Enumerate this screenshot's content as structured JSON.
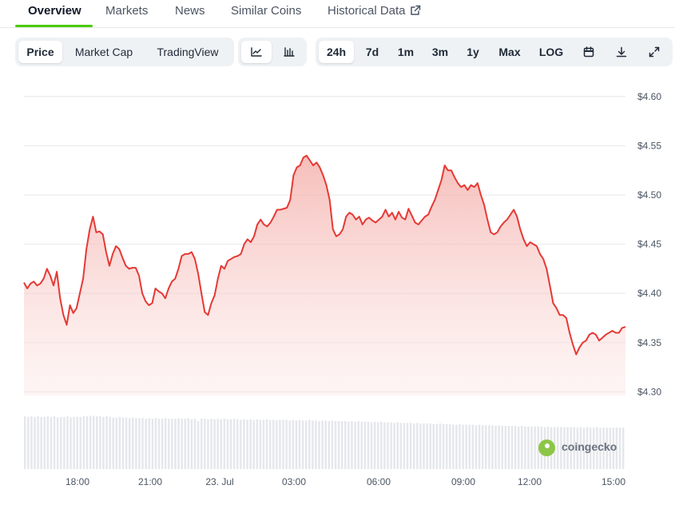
{
  "tabs": [
    {
      "label": "Overview",
      "active": true
    },
    {
      "label": "Markets"
    },
    {
      "label": "News"
    },
    {
      "label": "Similar Coins"
    },
    {
      "label": "Historical Data",
      "icon": "external-link-icon"
    }
  ],
  "metric_buttons": [
    {
      "label": "Price",
      "active": true
    },
    {
      "label": "Market Cap"
    },
    {
      "label": "TradingView"
    }
  ],
  "chart_type_buttons": [
    {
      "icon": "line-chart-icon",
      "active": true
    },
    {
      "icon": "candlestick-chart-icon"
    }
  ],
  "range_buttons": [
    {
      "label": "24h",
      "active": true
    },
    {
      "label": "7d"
    },
    {
      "label": "1m"
    },
    {
      "label": "3m"
    },
    {
      "label": "1y"
    },
    {
      "label": "Max"
    },
    {
      "label": "LOG"
    }
  ],
  "toolbar_icons": [
    "calendar-icon",
    "download-icon",
    "expand-icon"
  ],
  "watermark": "coingecko",
  "colors": {
    "accent": "#4bcc00",
    "line": "#e53935",
    "fill": "#f5c9c6",
    "grid": "#e5e7eb",
    "volume": "#e5e7eb"
  },
  "chart_data": {
    "type": "area",
    "title": "",
    "xlabel": "",
    "ylabel": "",
    "y_ticks": [
      "$4.60",
      "$4.55",
      "$4.50",
      "$4.45",
      "$4.40",
      "$4.35",
      "$4.30"
    ],
    "ylim": [
      4.28,
      4.625
    ],
    "x_ticks": [
      "18:00",
      "21:00",
      "23. Jul",
      "03:00",
      "06:00",
      "09:00",
      "12:00",
      "15:00"
    ],
    "grid": true,
    "legend": "none",
    "series": [
      {
        "values": [
          4.411,
          4.405,
          4.41,
          4.412,
          4.408,
          4.41,
          4.415,
          4.425,
          4.418,
          4.408,
          4.422,
          4.395,
          4.378,
          4.368,
          4.388,
          4.38,
          4.385,
          4.4,
          4.415,
          4.445,
          4.465,
          4.478,
          4.462,
          4.463,
          4.46,
          4.442,
          4.428,
          4.44,
          4.448,
          4.445,
          4.436,
          4.428,
          4.425,
          4.426,
          4.426,
          4.418,
          4.4,
          4.392,
          4.388,
          4.39,
          4.405,
          4.402,
          4.4,
          4.395,
          4.405,
          4.412,
          4.415,
          4.425,
          4.438,
          4.44,
          4.44,
          4.442,
          4.435,
          4.42,
          4.4,
          4.381,
          4.378,
          4.39,
          4.398,
          4.415,
          4.428,
          4.425,
          4.433,
          4.435,
          4.437,
          4.438,
          4.44,
          4.45,
          4.455,
          4.452,
          4.458,
          4.47,
          4.475,
          4.47,
          4.468,
          4.472,
          4.478,
          4.485,
          4.485,
          4.486,
          4.487,
          4.495,
          4.52,
          4.528,
          4.53,
          4.538,
          4.54,
          4.535,
          4.53,
          4.533,
          4.528,
          4.52,
          4.51,
          4.495,
          4.465,
          4.458,
          4.46,
          4.465,
          4.478,
          4.482,
          4.48,
          4.475,
          4.478,
          4.47,
          4.475,
          4.477,
          4.474,
          4.472,
          4.475,
          4.478,
          4.485,
          4.478,
          4.482,
          4.475,
          4.483,
          4.477,
          4.475,
          4.486,
          4.479,
          4.472,
          4.47,
          4.474,
          4.478,
          4.48,
          4.488,
          4.495,
          4.505,
          4.515,
          4.53,
          4.525,
          4.525,
          4.518,
          4.512,
          4.508,
          4.51,
          4.505,
          4.51,
          4.508,
          4.512,
          4.5,
          4.49,
          4.475,
          4.462,
          4.46,
          4.462,
          4.468,
          4.472,
          4.475,
          4.48,
          4.485,
          4.478,
          4.465,
          4.455,
          4.448,
          4.452,
          4.45,
          4.448,
          4.44,
          4.435,
          4.425,
          4.408,
          4.39,
          4.385,
          4.378,
          4.378,
          4.375,
          4.36,
          4.348,
          4.338,
          4.345,
          4.35,
          4.352,
          4.358,
          4.36,
          4.358,
          4.352,
          4.355,
          4.358,
          4.36,
          4.362,
          4.36,
          4.36,
          4.365,
          4.366
        ]
      }
    ],
    "volume": [
      0.88,
      0.87,
      0.88,
      0.87,
      0.88,
      0.87,
      0.87,
      0.88,
      0.87,
      0.88,
      0.86,
      0.87,
      0.87,
      0.88,
      0.86,
      0.87,
      0.87,
      0.87,
      0.88,
      0.88,
      0.89,
      0.88,
      0.88,
      0.88,
      0.87,
      0.88,
      0.87,
      0.86,
      0.86,
      0.87,
      0.86,
      0.86,
      0.85,
      0.86,
      0.85,
      0.85,
      0.85,
      0.84,
      0.85,
      0.84,
      0.85,
      0.84,
      0.84,
      0.85,
      0.84,
      0.84,
      0.84,
      0.85,
      0.84,
      0.84,
      0.85,
      0.83,
      0.84,
      0.8,
      0.84,
      0.84,
      0.83,
      0.84,
      0.83,
      0.84,
      0.83,
      0.84,
      0.83,
      0.83,
      0.84,
      0.83,
      0.82,
      0.83,
      0.82,
      0.83,
      0.82,
      0.83,
      0.82,
      0.82,
      0.83,
      0.82,
      0.82,
      0.81,
      0.82,
      0.82,
      0.82,
      0.81,
      0.82,
      0.81,
      0.82,
      0.81,
      0.81,
      0.82,
      0.81,
      0.81,
      0.8,
      0.81,
      0.81,
      0.8,
      0.81,
      0.8,
      0.8,
      0.8,
      0.8,
      0.79,
      0.8,
      0.79,
      0.8,
      0.79,
      0.79,
      0.79,
      0.78,
      0.79,
      0.78,
      0.79,
      0.78,
      0.78,
      0.78,
      0.77,
      0.78,
      0.77,
      0.77,
      0.77,
      0.77,
      0.76,
      0.77,
      0.76,
      0.76,
      0.76,
      0.76,
      0.75,
      0.75,
      0.76,
      0.75,
      0.75,
      0.75,
      0.74,
      0.74,
      0.75,
      0.74,
      0.74,
      0.74,
      0.74,
      0.73,
      0.74,
      0.73,
      0.73,
      0.73,
      0.73,
      0.72,
      0.73,
      0.72,
      0.72,
      0.72,
      0.72,
      0.72,
      0.71,
      0.72,
      0.71,
      0.71,
      0.71,
      0.71,
      0.71,
      0.71,
      0.7,
      0.71,
      0.7,
      0.7,
      0.7,
      0.7,
      0.7,
      0.7,
      0.7,
      0.7,
      0.69,
      0.7,
      0.69,
      0.7,
      0.69,
      0.69,
      0.7,
      0.69,
      0.69,
      0.69,
      0.69,
      0.69,
      0.69,
      0.69,
      0.69
    ]
  }
}
